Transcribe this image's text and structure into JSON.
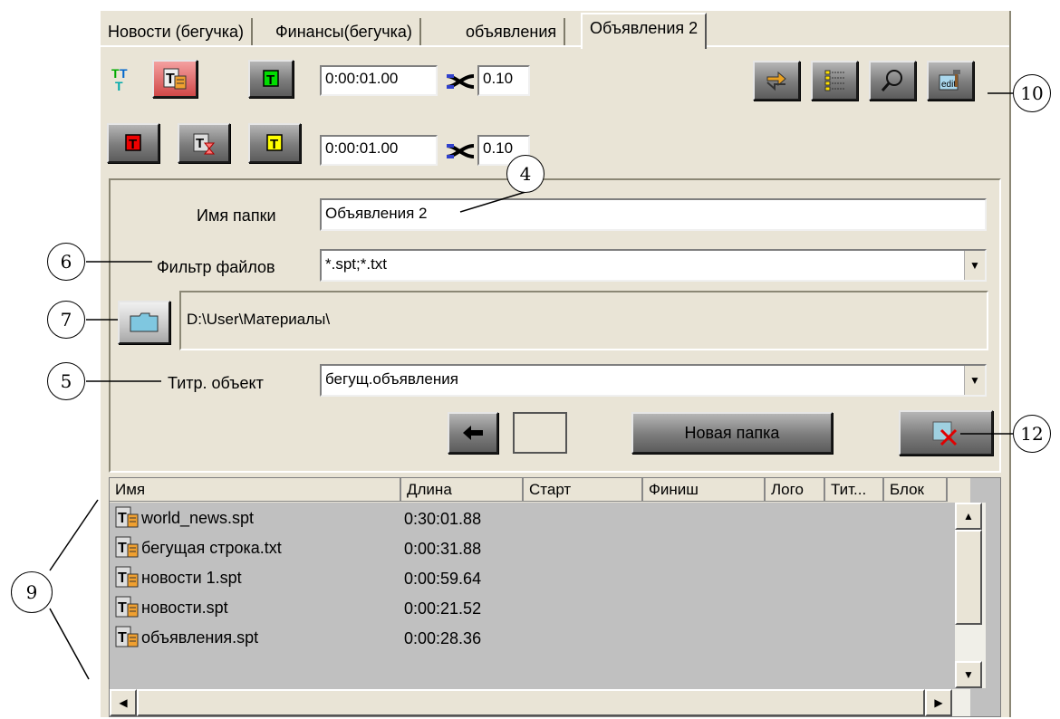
{
  "tabs": [
    "Новости (бегучка)",
    "Финансы(бегучка)",
    "объявления",
    "Объявления 2"
  ],
  "toolbar": {
    "row1": {
      "time": "0:00:01.00",
      "value": "0.10"
    },
    "row2": {
      "time": "0:00:01.00",
      "value": "0.10"
    },
    "icons_left_row1": [
      "titles-icon",
      "text-file-button",
      "green-t-button"
    ],
    "icons_left_row2": [
      "red-t-button",
      "hourglass-t-button",
      "yellow-t-button"
    ],
    "icons_right": [
      "sync-icon",
      "list-icon",
      "search-icon",
      "edit-icon"
    ]
  },
  "form": {
    "folder_name_label": "Имя папки",
    "folder_name_value": "Объявления 2",
    "filter_label": "Фильтр файлов",
    "filter_value": "*.spt;*.txt",
    "path_value": "D:\\User\\Материалы\\",
    "titer_label": "Титр. объект",
    "titer_value": "бегущ.объявления",
    "new_folder_button": "Новая папка"
  },
  "list": {
    "columns": [
      "Имя",
      "Длина",
      "Старт",
      "Финиш",
      "Лого",
      "Тит...",
      "Блок"
    ],
    "rows": [
      {
        "name": "world_news.spt",
        "duration": "0:30:01.88"
      },
      {
        "name": "бегущая строка.txt",
        "duration": "0:00:31.88"
      },
      {
        "name": "новости 1.spt",
        "duration": "0:00:59.64"
      },
      {
        "name": "новости.spt",
        "duration": "0:00:21.52"
      },
      {
        "name": "объявления.spt",
        "duration": "0:00:28.36"
      }
    ]
  },
  "callouts": [
    "4",
    "5",
    "6",
    "7",
    "9",
    "10",
    "12"
  ],
  "colors": {
    "panel_bg": "#e9e4d6",
    "list_bg": "#c0c0c0",
    "accent_red": "#cc0000",
    "accent_green": "#00cc00",
    "accent_yellow": "#ffff00"
  }
}
